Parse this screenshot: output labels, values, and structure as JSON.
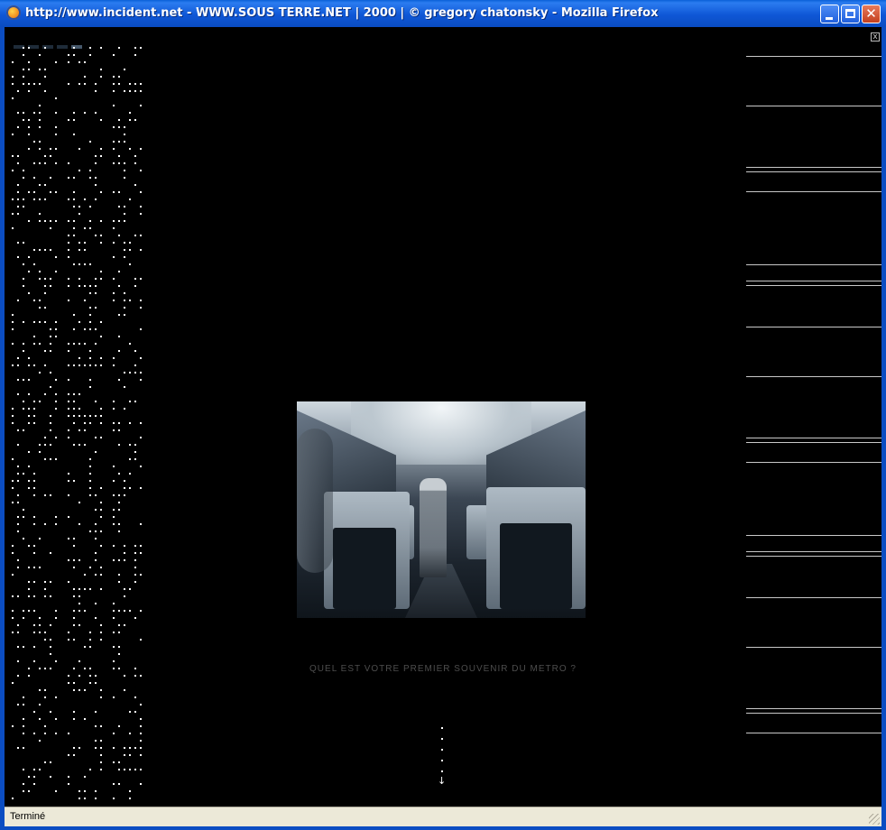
{
  "window": {
    "title": "http://www.incident.net - WWW.SOUS TERRE.NET  |  2000  | © gregory chatonsky - Mozilla Firefox",
    "icon": "firefox-icon",
    "controls": [
      "minimize-icon",
      "maximize-icon",
      "close-icon"
    ],
    "close_glyph": "✕",
    "accent": "#0a4cc2"
  },
  "page": {
    "background": "#000000",
    "close_glyph": "x",
    "image": "metro-car-interior-photo",
    "question": "QUEL EST VOTRE PREMIER SOUVENIR DU METRO ?",
    "scroll_arrow": "↓"
  },
  "status": {
    "text": "Terminé"
  }
}
